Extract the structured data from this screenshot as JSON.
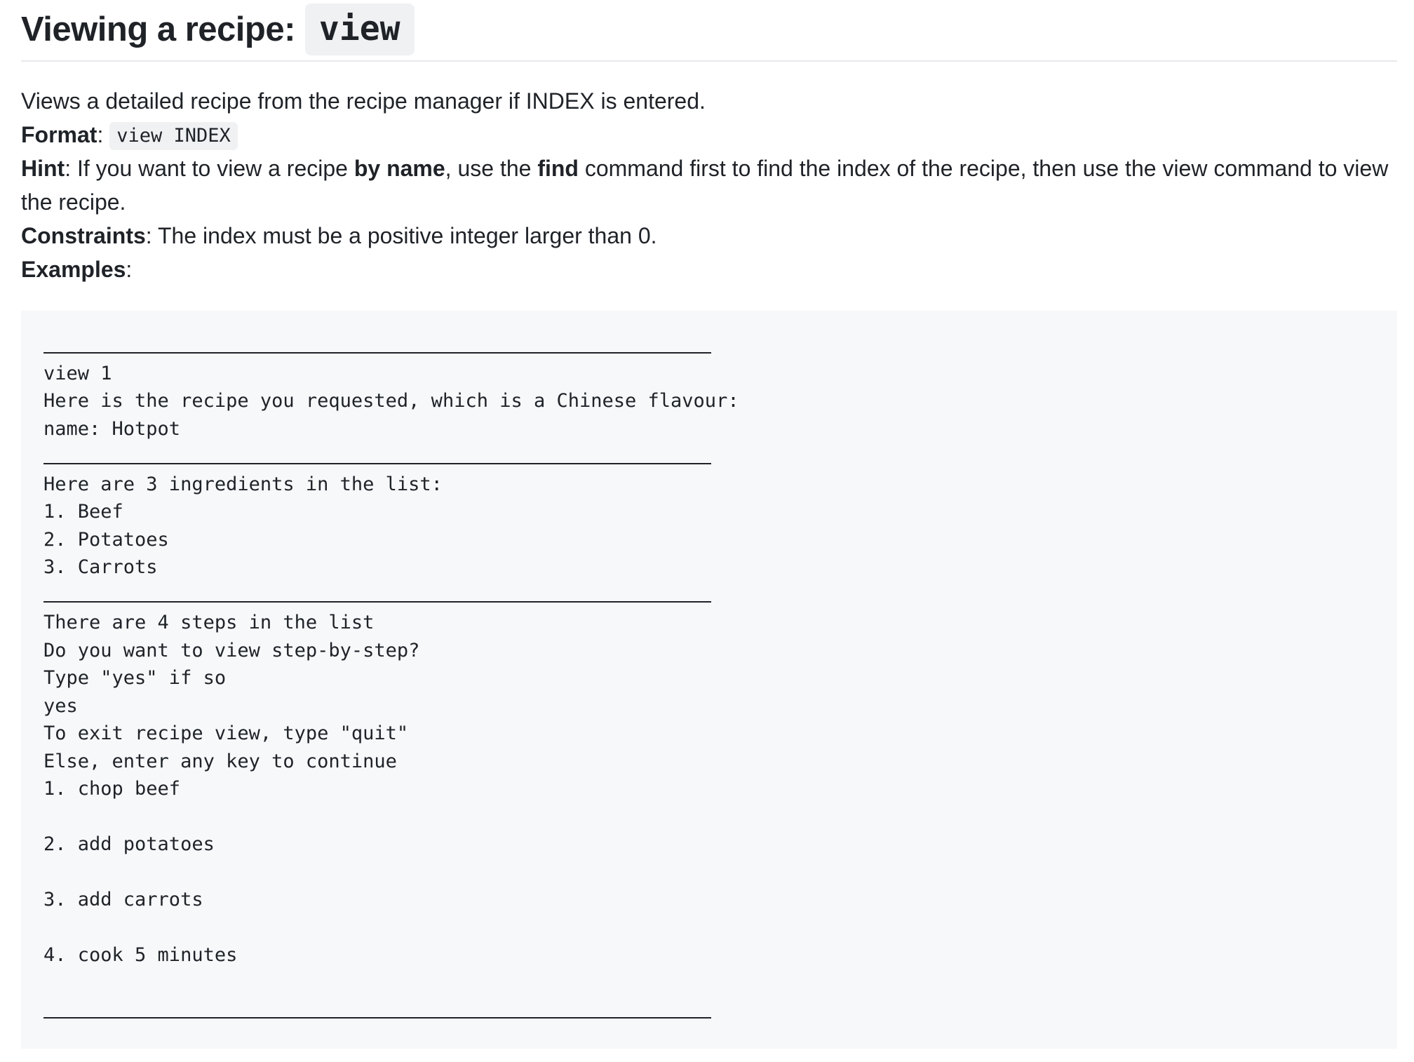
{
  "section": {
    "title": "Viewing a recipe:",
    "command": "view"
  },
  "description": {
    "intro": "Views a detailed recipe from the recipe manager if INDEX is entered.",
    "format_label": "Format",
    "format_colon": ": ",
    "format_code": "view INDEX",
    "hint_label": "Hint",
    "hint_part1": ": If you want to view a recipe ",
    "hint_bold1": "by name",
    "hint_part2": ", use the ",
    "hint_bold2": "find",
    "hint_part3": " command first to find the index of the recipe, then use the view command to view the recipe.",
    "constraints_label": "Constraints",
    "constraints_text": ": The index must be a positive integer larger than 0.",
    "examples_label": "Examples",
    "examples_colon": ":"
  },
  "example_output": {
    "lines": [
      {
        "kind": "rule"
      },
      {
        "kind": "text",
        "text": "view 1"
      },
      {
        "kind": "text",
        "text": "Here is the recipe you requested, which is a Chinese flavour:"
      },
      {
        "kind": "text",
        "text": "name: Hotpot"
      },
      {
        "kind": "rule"
      },
      {
        "kind": "text",
        "text": "Here are 3 ingredients in the list:"
      },
      {
        "kind": "text",
        "text": "1. Beef"
      },
      {
        "kind": "text",
        "text": "2. Potatoes"
      },
      {
        "kind": "text",
        "text": "3. Carrots"
      },
      {
        "kind": "rule"
      },
      {
        "kind": "text",
        "text": "There are 4 steps in the list"
      },
      {
        "kind": "text",
        "text": "Do you want to view step-by-step?"
      },
      {
        "kind": "text",
        "text": "Type \"yes\" if so"
      },
      {
        "kind": "text",
        "text": "yes"
      },
      {
        "kind": "text",
        "text": "To exit recipe view, type \"quit\""
      },
      {
        "kind": "text",
        "text": "Else, enter any key to continue"
      },
      {
        "kind": "text",
        "text": "1. chop beef"
      },
      {
        "kind": "text",
        "text": ""
      },
      {
        "kind": "text",
        "text": "2. add potatoes"
      },
      {
        "kind": "text",
        "text": ""
      },
      {
        "kind": "text",
        "text": "3. add carrots"
      },
      {
        "kind": "text",
        "text": ""
      },
      {
        "kind": "text",
        "text": "4. cook 5 minutes"
      },
      {
        "kind": "text",
        "text": ""
      },
      {
        "kind": "rule"
      }
    ]
  }
}
